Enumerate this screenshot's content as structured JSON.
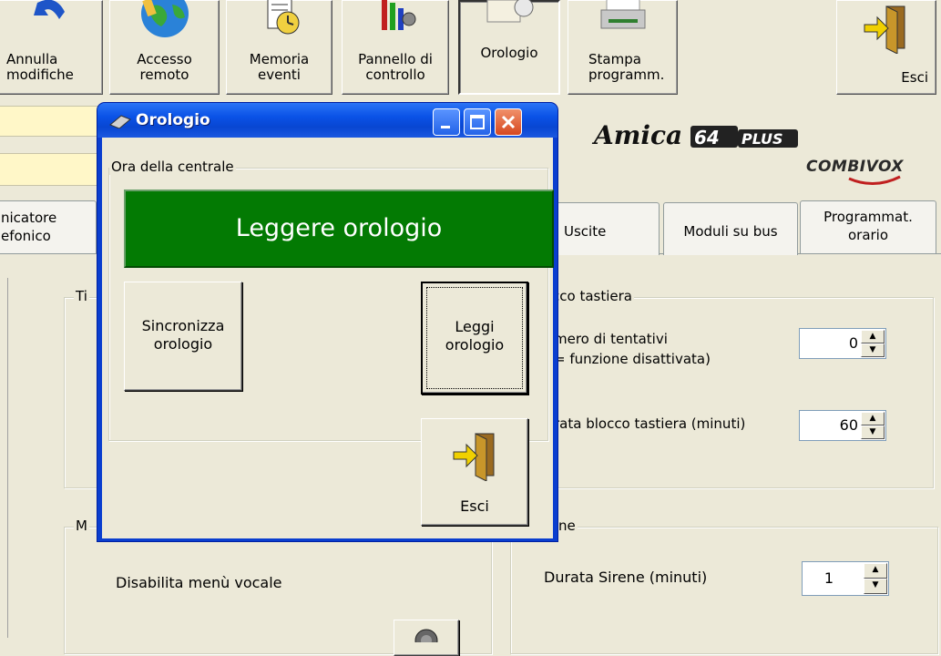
{
  "toolbar": {
    "buttons": [
      {
        "id": "annulla",
        "lines": [
          "Annulla",
          "modifiche"
        ],
        "icon": "undo-icon"
      },
      {
        "id": "accesso",
        "lines": [
          "Accesso",
          "remoto"
        ],
        "icon": "globe-icon"
      },
      {
        "id": "memoria",
        "lines": [
          "Memoria",
          "eventi"
        ],
        "icon": "event-memory-icon"
      },
      {
        "id": "pannello",
        "lines": [
          "Pannello di",
          "controllo"
        ],
        "icon": "control-panel-icon"
      },
      {
        "id": "orologio",
        "lines": [
          "Orologio",
          ""
        ],
        "icon": "clock-icon"
      },
      {
        "id": "stampa",
        "lines": [
          "Stampa",
          "programm."
        ],
        "icon": "printer-icon"
      },
      {
        "id": "esci",
        "lines": [
          "Esci",
          ""
        ],
        "icon": "exit-door-icon"
      }
    ]
  },
  "brand": {
    "logo_text": "Amica 64 PLUS",
    "company": "COMBIVOX"
  },
  "tabs": [
    {
      "lines": [
        "nicatore",
        "efonico"
      ]
    },
    {
      "lines": [
        "Uscite",
        ""
      ]
    },
    {
      "lines": [
        "Moduli su bus",
        ""
      ]
    },
    {
      "lines": [
        "Programmat.",
        "orario"
      ]
    }
  ],
  "background_panels": {
    "tipo_title": "Ti",
    "blocco_title": "cco tastiera",
    "tentativi_label_1": "mero di tentativi",
    "tentativi_label_2": "= funzione disattivata)",
    "tentativi_value": "0",
    "durata_blocco_label": "rata blocco tastiera (minuti)",
    "durata_blocco_value": "60",
    "menu_title": "M",
    "sirene_title": "ne",
    "disabilita_label": "Disabilita menù vocale",
    "durata_sirene_label": "Durata Sirene  (minuti)",
    "durata_sirene_value": "1"
  },
  "dialog": {
    "title": "Orologio",
    "group_title": "Ora della centrale",
    "status_text": "Leggere orologio",
    "sync_button": [
      "Sincronizza",
      "orologio"
    ],
    "read_button": [
      "Leggi",
      "orologio"
    ],
    "exit_button": "Esci",
    "colors": {
      "status_bg": "#037a03",
      "title_bar": "#0a52e6"
    }
  }
}
